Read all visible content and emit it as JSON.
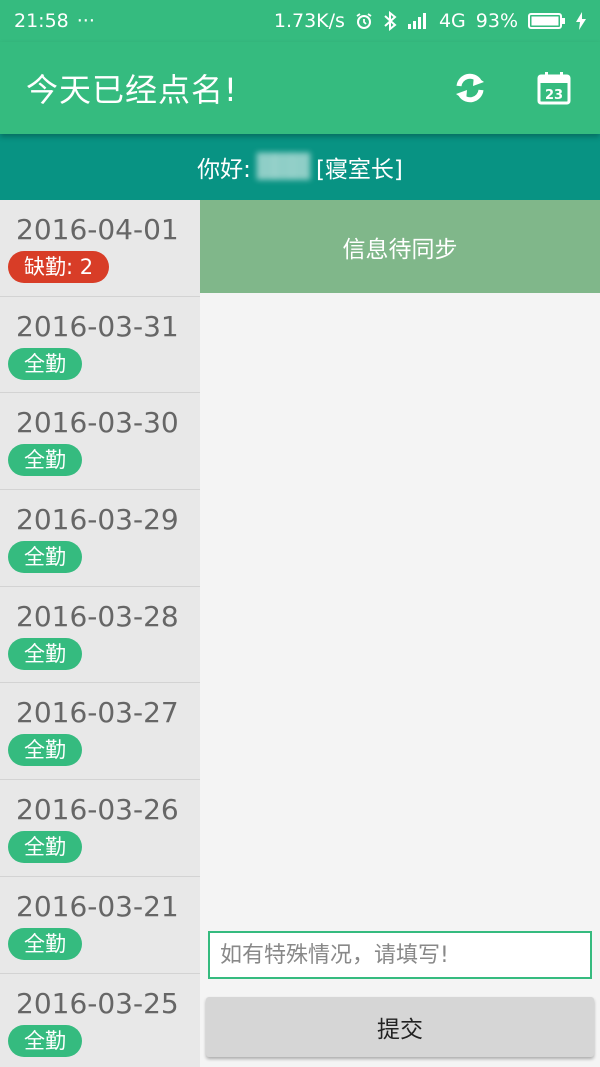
{
  "status_bar": {
    "time": "21:58",
    "more": "···",
    "network_speed": "1.73K/s",
    "network_type": "4G",
    "battery_percent": "93%",
    "icons": [
      "alarm-icon",
      "bluetooth-icon",
      "signal-icon",
      "battery-icon",
      "charging-icon"
    ]
  },
  "app_bar": {
    "title": "今天已经点名!",
    "actions": [
      "refresh-icon",
      "calendar-icon"
    ],
    "calendar_day": "23"
  },
  "greeting": {
    "prefix": "你好:",
    "name": "███",
    "role": "[寝室长]"
  },
  "attendance_list": [
    {
      "date": "2016-04-01",
      "badge": "缺勤: 2",
      "status": "absent"
    },
    {
      "date": "2016-03-31",
      "badge": "全勤",
      "status": "full"
    },
    {
      "date": "2016-03-30",
      "badge": "全勤",
      "status": "full"
    },
    {
      "date": "2016-03-29",
      "badge": "全勤",
      "status": "full"
    },
    {
      "date": "2016-03-28",
      "badge": "全勤",
      "status": "full"
    },
    {
      "date": "2016-03-27",
      "badge": "全勤",
      "status": "full"
    },
    {
      "date": "2016-03-26",
      "badge": "全勤",
      "status": "full"
    },
    {
      "date": "2016-03-21",
      "badge": "全勤",
      "status": "full"
    },
    {
      "date": "2016-03-25",
      "badge": "全勤",
      "status": "full"
    }
  ],
  "panel": {
    "sync_status": "信息待同步",
    "note_value": "",
    "note_placeholder": "如有特殊情况，请填写!",
    "submit_label": "提交"
  },
  "colors": {
    "primary": "#35bb7f",
    "greeting_bg": "#089383",
    "sync_banner": "#80b78a",
    "absent": "#d83d27"
  }
}
